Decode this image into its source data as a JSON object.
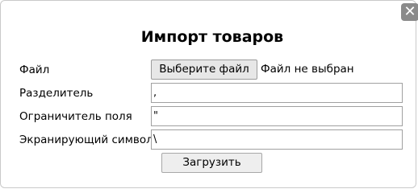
{
  "dialog": {
    "title": "Импорт товаров",
    "close_icon": "close-icon"
  },
  "form": {
    "file": {
      "label": "Файл",
      "button_label": "Выберите файл",
      "status": "Файл не выбран"
    },
    "separator": {
      "label": "Разделитель",
      "value": ","
    },
    "field_delimiter": {
      "label": "Ограничитель поля",
      "value": "\""
    },
    "escape_char": {
      "label": "Экранирующий символ",
      "value": "\\"
    },
    "submit_label": "Загрузить"
  }
}
